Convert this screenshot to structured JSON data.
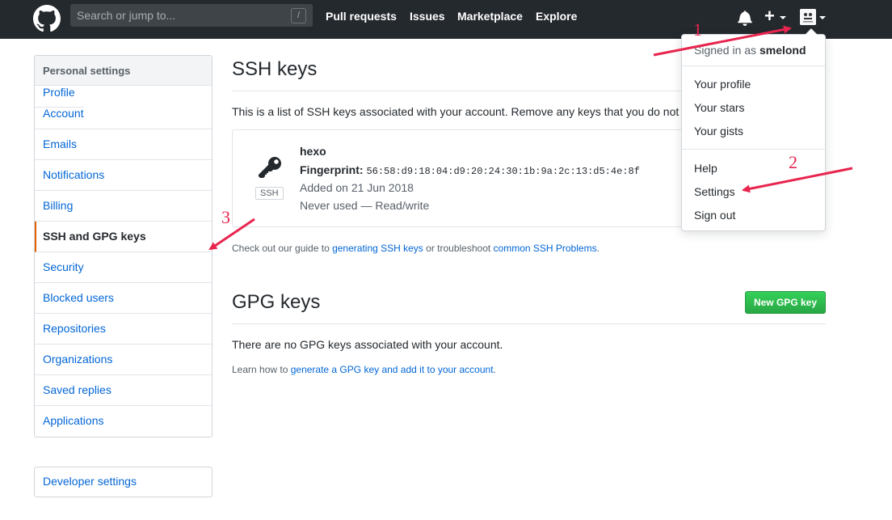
{
  "header": {
    "search_placeholder": "Search or jump to...",
    "search_shortcut": "/",
    "nav": [
      "Pull requests",
      "Issues",
      "Marketplace",
      "Explore"
    ],
    "plus": "+"
  },
  "sidebar": {
    "heading": "Personal settings",
    "items": [
      {
        "label": "Profile"
      },
      {
        "label": "Account"
      },
      {
        "label": "Emails"
      },
      {
        "label": "Notifications"
      },
      {
        "label": "Billing"
      },
      {
        "label": "SSH and GPG keys",
        "selected": true
      },
      {
        "label": "Security"
      },
      {
        "label": "Blocked users"
      },
      {
        "label": "Repositories"
      },
      {
        "label": "Organizations"
      },
      {
        "label": "Saved replies"
      },
      {
        "label": "Applications"
      }
    ],
    "developer_settings": "Developer settings"
  },
  "ssh": {
    "title": "SSH keys",
    "description": "This is a list of SSH keys associated with your account. Remove any keys that you do not",
    "key": {
      "name": "hexo",
      "fingerprint_label": "Fingerprint:",
      "fingerprint": "56:58:d9:18:04:d9:20:24:30:1b:9a:2c:13:d5:4e:8f",
      "badge": "SSH",
      "added": "Added on 21 Jun 2018",
      "usage": "Never used — Read/write"
    },
    "help": {
      "prefix": "Check out our guide to ",
      "link1": "generating SSH keys",
      "middle": " or troubleshoot ",
      "link2": "common SSH Problems",
      "suffix": "."
    }
  },
  "gpg": {
    "title": "GPG keys",
    "new_button": "New GPG key",
    "empty": "There are no GPG keys associated with your account.",
    "help": {
      "prefix": "Learn how to ",
      "link": "generate a GPG key and add it to your account",
      "suffix": "."
    }
  },
  "dropdown": {
    "signed_in_prefix": "Signed in as ",
    "username": "smelond",
    "items_1": [
      "Your profile",
      "Your stars",
      "Your gists"
    ],
    "items_2": [
      "Help",
      "Settings",
      "Sign out"
    ]
  },
  "annotations": {
    "labels": [
      "1",
      "2",
      "3"
    ],
    "color": "#e8254f"
  },
  "colors": {
    "header_bg": "#24292e",
    "link": "#0366d6",
    "selected_border": "#e36209",
    "button_green": "#28a745"
  }
}
